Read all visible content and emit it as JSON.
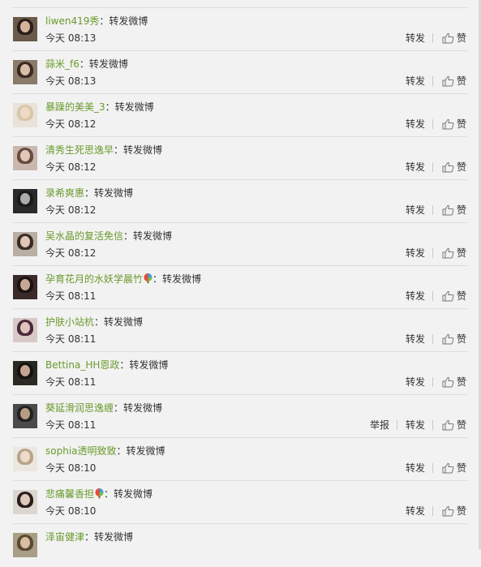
{
  "rows": [
    {
      "name": "liwen419秀",
      "text": "转发微博",
      "time": "今天 08:13",
      "badge": false,
      "report": "",
      "forward": "转发",
      "like": "赞",
      "avatar": {
        "bg": "#6b5a4a",
        "hair": "#2a1f1a",
        "skin": "#e8c4a8"
      }
    },
    {
      "name": "蒜米_f6",
      "text": "转发微博",
      "time": "今天 08:13",
      "badge": false,
      "report": "",
      "forward": "转发",
      "like": "赞",
      "avatar": {
        "bg": "#8a7a6a",
        "hair": "#3b2a20",
        "skin": "#e9cdb5"
      }
    },
    {
      "name": "暴躁的美美_3",
      "text": "转发微博",
      "time": "今天 08:12",
      "badge": false,
      "report": "",
      "forward": "转发",
      "like": "赞",
      "avatar": {
        "bg": "#e8e2da",
        "hair": "#d8c7a8",
        "skin": "#f2dccb"
      }
    },
    {
      "name": "清秀生死思逸早",
      "text": "转发微博",
      "time": "今天 08:12",
      "badge": false,
      "report": "",
      "forward": "转发",
      "like": "赞",
      "avatar": {
        "bg": "#c9b7b0",
        "hair": "#6a4a3e",
        "skin": "#f0d6c6"
      }
    },
    {
      "name": "录希爽惠",
      "text": "转发微博",
      "time": "今天 08:12",
      "badge": false,
      "report": "",
      "forward": "转发",
      "like": "赞",
      "avatar": {
        "bg": "#2a2a2a",
        "hair": "#1a1a1a",
        "skin": "#bdbdbd"
      }
    },
    {
      "name": "吴水晶的复活免信",
      "text": "转发微博",
      "time": "今天 08:12",
      "badge": false,
      "report": "",
      "forward": "转发",
      "like": "赞",
      "avatar": {
        "bg": "#b8aea4",
        "hair": "#3a2c24",
        "skin": "#f1d8c6"
      }
    },
    {
      "name": "孕育花月的水妖学晨竹",
      "text": "转发微博",
      "time": "今天 08:11",
      "badge": true,
      "report": "",
      "forward": "转发",
      "like": "赞",
      "avatar": {
        "bg": "#3a2a2a",
        "hair": "#1c1212",
        "skin": "#d9b8a4"
      }
    },
    {
      "name": "护肤小站杭",
      "text": "转发微博",
      "time": "今天 08:11",
      "badge": false,
      "report": "",
      "forward": "转发",
      "like": "赞",
      "avatar": {
        "bg": "#d9c8c8",
        "hair": "#4a2a3a",
        "skin": "#f0d4cc"
      }
    },
    {
      "name": "Bettina_HH恩政",
      "text": "转发微博",
      "time": "今天 08:11",
      "badge": false,
      "report": "",
      "forward": "转发",
      "like": "赞",
      "avatar": {
        "bg": "#2a2a22",
        "hair": "#161210",
        "skin": "#d6b69e"
      }
    },
    {
      "name": "葵延滑润思逸缠",
      "text": "转发微博",
      "time": "今天 08:11",
      "badge": false,
      "report": "举报",
      "forward": "转发",
      "like": "赞",
      "avatar": {
        "bg": "#4a4a4a",
        "hair": "#222",
        "skin": "#c9a88e"
      }
    },
    {
      "name": "sophia透明致致",
      "text": "转发微博",
      "time": "今天 08:10",
      "badge": false,
      "report": "",
      "forward": "转发",
      "like": "赞",
      "avatar": {
        "bg": "#ece7e0",
        "hair": "#b8a48a",
        "skin": "#f3e1d2"
      }
    },
    {
      "name": "悲痛馨香担",
      "text": "转发微博",
      "time": "今天 08:10",
      "badge": true,
      "report": "",
      "forward": "转发",
      "like": "赞",
      "avatar": {
        "bg": "#dcd6d0",
        "hair": "#2a1e1a",
        "skin": "#f2dacb"
      }
    },
    {
      "name": "泽宙健津",
      "text": "转发微博",
      "time": "",
      "badge": false,
      "report": "",
      "forward": "",
      "like": "",
      "avatar": {
        "bg": "#a89e86",
        "hair": "#5a4a32",
        "skin": "#e6ccb0"
      }
    }
  ]
}
